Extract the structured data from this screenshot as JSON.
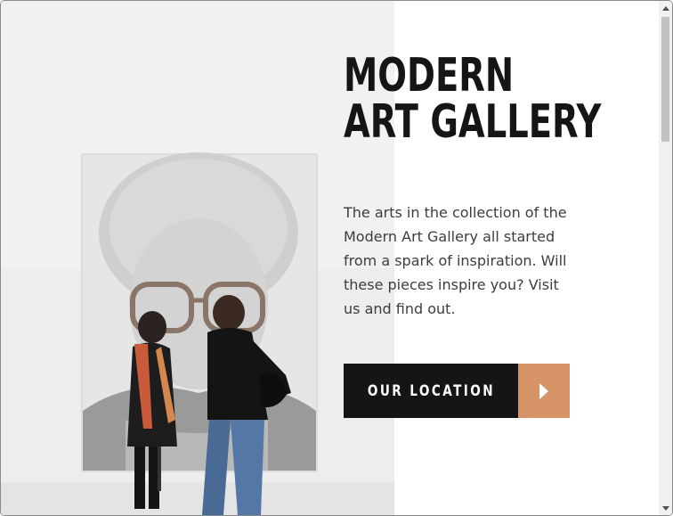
{
  "hero": {
    "title_line1": "MODERN",
    "title_line2": "ART GALLERY",
    "description": "The arts in the collection of the Modern Art Gallery all started from a spark of inspiration. Will these pieces inspire you? Visit us and find out."
  },
  "cta": {
    "label": "OUR LOCATION",
    "icon": "chevron-right-icon"
  },
  "colors": {
    "text_dark": "#151515",
    "button_dark": "#151515",
    "accent": "#d69466",
    "body_text": "#3d3d3d"
  }
}
